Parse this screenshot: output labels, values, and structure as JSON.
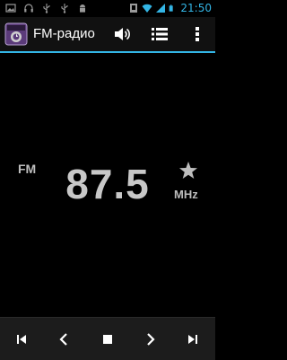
{
  "status_bar": {
    "time": "21:50",
    "left_icons": [
      "gallery-icon",
      "headset-icon",
      "usb-icon",
      "usb-icon",
      "android-debug-icon"
    ],
    "right_icons": [
      "notification-icon",
      "wifi-icon",
      "signal-icon",
      "battery-icon"
    ]
  },
  "action_bar": {
    "title": "FM-радио",
    "icons": [
      "volume-icon",
      "list-icon",
      "overflow-menu-icon"
    ]
  },
  "tuner": {
    "band": "FM",
    "frequency": "87.5",
    "unit": "MHz",
    "favorite_icon": "star-icon"
  },
  "controls": [
    "seek-previous-icon",
    "step-back-icon",
    "stop-icon",
    "step-forward-icon",
    "seek-next-icon"
  ],
  "colors": {
    "accent": "#33b5e5",
    "background": "#000000",
    "text": "#c8c8c8"
  }
}
